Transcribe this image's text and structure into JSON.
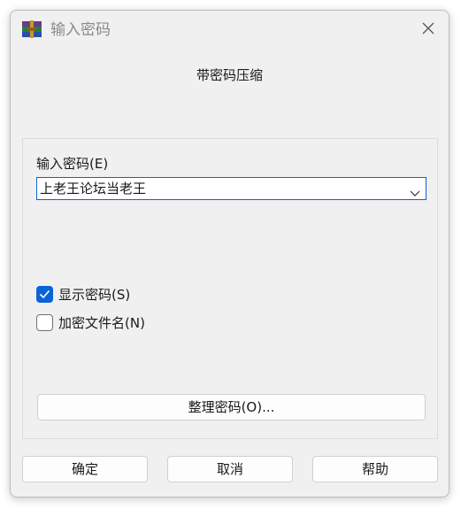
{
  "window": {
    "title": "输入密码",
    "subtitle": "带密码压缩"
  },
  "password": {
    "label": "输入密码(E)",
    "value": "上老王论坛当老王"
  },
  "options": {
    "show_password": {
      "label": "显示密码(S)",
      "checked": true
    },
    "encrypt_filenames": {
      "label": "加密文件名(N)",
      "checked": false
    }
  },
  "buttons": {
    "manage": "整理密码(O)...",
    "ok": "确定",
    "cancel": "取消",
    "help": "帮助"
  },
  "colors": {
    "accent": "#0a64d6",
    "window_bg": "#f0f0f0"
  },
  "icons": {
    "app": "winrar-icon",
    "close": "close-icon",
    "dropdown": "chevron-down-icon",
    "check": "checkmark-icon"
  }
}
